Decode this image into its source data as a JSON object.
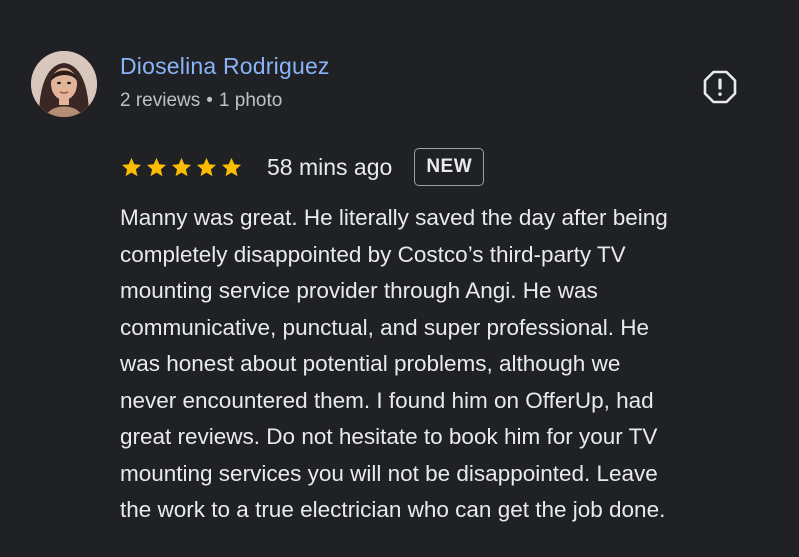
{
  "reviewer": {
    "name": "Dioselina Rodriguez",
    "reviews_count": "2 reviews",
    "separator": "•",
    "photos_count": "1 photo"
  },
  "review": {
    "rating": 5,
    "max_rating": 5,
    "time_ago": "58 mins ago",
    "badge": "NEW",
    "text_lines": [
      "Manny was great. He literally saved the day after being",
      "completely disappointed by Costco’s third-party TV",
      "mounting service provider through Angi. He was",
      "communicative, punctual, and super professional. He",
      "was honest about potential problems, although we",
      "never encountered them. I found him on OfferUp, had",
      "great reviews. Do not hesitate to book him for your TV",
      "mounting services you will not be disappointed. Leave",
      "the work to a true electrician who can get the job done."
    ]
  },
  "icons": {
    "report": "report-flag-icon",
    "star": "star-icon"
  },
  "colors": {
    "background": "#202124",
    "name_link": "#8ab4f8",
    "star": "#fbbc04",
    "text": "#e8eaed",
    "meta": "#bdc1c6"
  }
}
